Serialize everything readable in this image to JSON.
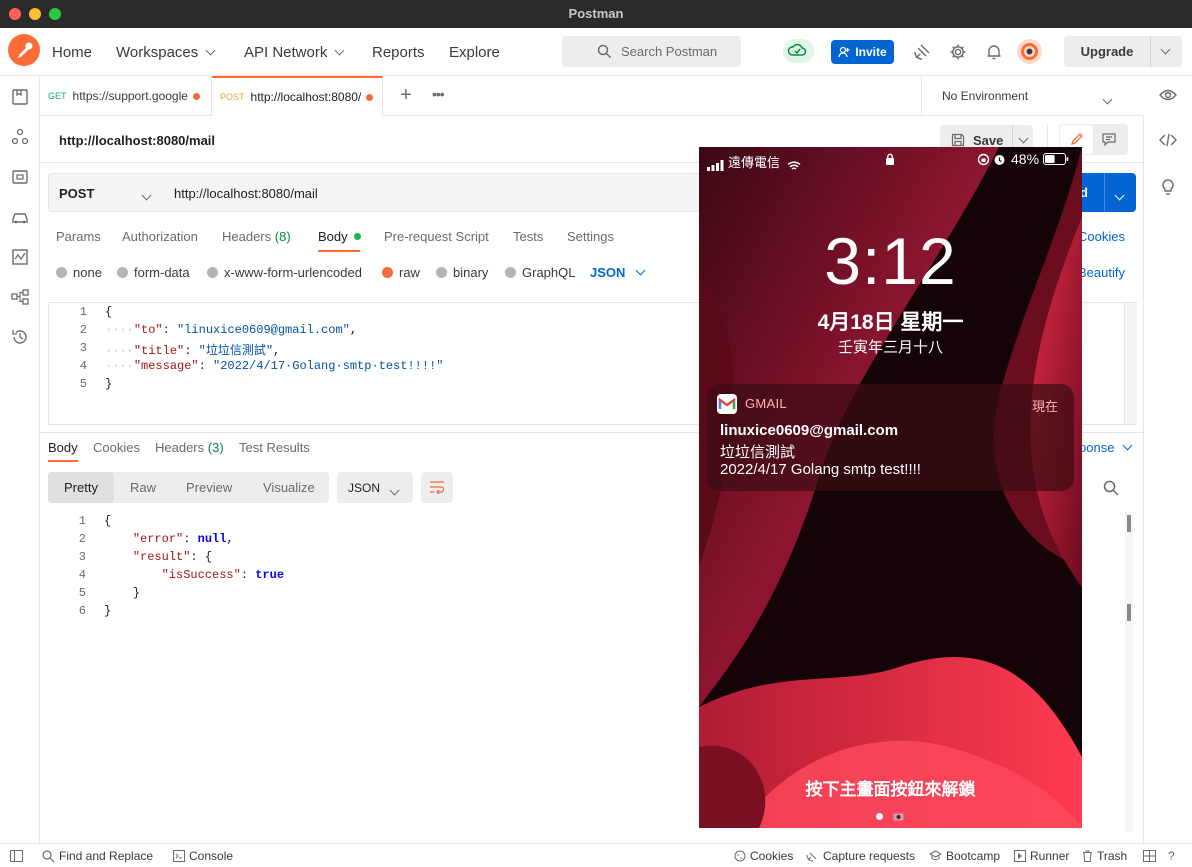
{
  "window": {
    "title": "Postman"
  },
  "nav": {
    "home": "Home",
    "workspaces": "Workspaces",
    "api_network": "API Network",
    "reports": "Reports",
    "explore": "Explore"
  },
  "search": {
    "placeholder": "Search Postman"
  },
  "header": {
    "invite": "Invite",
    "upgrade": "Upgrade"
  },
  "tabs": [
    {
      "method": "GET",
      "label": "https://support.google"
    },
    {
      "method": "POST",
      "label": "http://localhost:8080/"
    }
  ],
  "environment": {
    "selected": "No Environment"
  },
  "request": {
    "name": "http://localhost:8080/mail",
    "save": "Save",
    "method": "POST",
    "url": "http://localhost:8080/mail",
    "send_partial": "d",
    "cookies": "Cookies",
    "beautify": "Beautify"
  },
  "req_tabs": {
    "params": "Params",
    "authorization": "Authorization",
    "headers": "Headers",
    "headers_count": "(8)",
    "body": "Body",
    "pre_request": "Pre-request Script",
    "tests": "Tests",
    "settings": "Settings"
  },
  "body_types": {
    "none": "none",
    "form_data": "form-data",
    "urlencoded": "x-www-form-urlencoded",
    "raw": "raw",
    "binary": "binary",
    "graphql": "GraphQL",
    "lang": "JSON"
  },
  "request_body": [
    {
      "n": "1",
      "parts": [
        [
          "p",
          "{"
        ]
      ]
    },
    {
      "n": "2",
      "parts": [
        [
          "d",
          "····"
        ],
        [
          "k",
          "\"to\""
        ],
        [
          "p",
          ": "
        ],
        [
          "s",
          "\"linuxice0609@gmail.com\""
        ],
        [
          "p",
          ","
        ]
      ]
    },
    {
      "n": "3",
      "parts": [
        [
          "d",
          "····"
        ],
        [
          "k",
          "\"title\""
        ],
        [
          "p",
          ": "
        ],
        [
          "s",
          "\"垃垃信測試\""
        ],
        [
          "p",
          ","
        ]
      ]
    },
    {
      "n": "4",
      "parts": [
        [
          "d",
          "····"
        ],
        [
          "k",
          "\"message\""
        ],
        [
          "p",
          ": "
        ],
        [
          "s",
          "\"2022/4/17·Golang·smtp·test!!!!\""
        ]
      ]
    },
    {
      "n": "5",
      "parts": [
        [
          "p",
          "}"
        ]
      ]
    }
  ],
  "resp_tabs": {
    "body": "Body",
    "cookies": "Cookies",
    "headers": "Headers",
    "headers_count": "(3)",
    "test_results": "Test Results",
    "save_response_partial": "ponse"
  },
  "resp_view": {
    "pretty": "Pretty",
    "raw": "Raw",
    "preview": "Preview",
    "visualize": "Visualize",
    "lang": "JSON"
  },
  "response_body": [
    {
      "n": "1",
      "parts": [
        [
          "p",
          "{"
        ]
      ]
    },
    {
      "n": "2",
      "parts": [
        [
          "p",
          "    "
        ],
        [
          "k",
          "\"error\""
        ],
        [
          "p",
          ": "
        ],
        [
          "w",
          "null"
        ],
        [
          "p",
          ","
        ]
      ]
    },
    {
      "n": "3",
      "parts": [
        [
          "p",
          "    "
        ],
        [
          "k",
          "\"result\""
        ],
        [
          "p",
          ": {"
        ]
      ]
    },
    {
      "n": "4",
      "parts": [
        [
          "p",
          "        "
        ],
        [
          "k",
          "\"isSuccess\""
        ],
        [
          "p",
          ": "
        ],
        [
          "w",
          "true"
        ]
      ]
    },
    {
      "n": "5",
      "parts": [
        [
          "p",
          "    }"
        ]
      ]
    },
    {
      "n": "6",
      "parts": [
        [
          "p",
          "}"
        ]
      ]
    }
  ],
  "statusbar": {
    "find_replace": "Find and Replace",
    "console": "Console",
    "cookies": "Cookies",
    "capture": "Capture requests",
    "bootcamp": "Bootcamp",
    "runner": "Runner",
    "trash": "Trash"
  },
  "phone": {
    "carrier": "遠傳電信",
    "battery": "48%",
    "time": "3:12",
    "date": "4月18日 星期一",
    "lunar": "壬寅年三月十八",
    "notification": {
      "app": "GMAIL",
      "when": "現在",
      "from": "linuxice0609@gmail.com",
      "subject": "垃垃信測試",
      "body": "2022/4/17 Golang smtp test!!!!"
    },
    "unlock_hint": "按下主畫面按鈕來解鎖"
  },
  "colors": {
    "accent": "#f26b3a",
    "link": "#0265d2",
    "active_dot": "#0cbb52"
  }
}
